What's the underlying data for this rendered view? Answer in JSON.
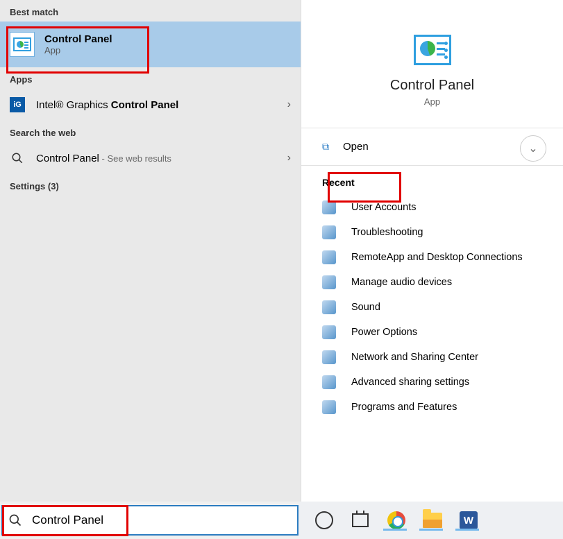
{
  "left": {
    "best_match_header": "Best match",
    "best_match": {
      "title": "Control Panel",
      "subtitle": "App"
    },
    "apps_header": "Apps",
    "intel_prefix": "Intel® Graphics ",
    "intel_bold": "Control Panel",
    "web_header": "Search the web",
    "web_title": "Control Panel",
    "web_sub": " - See web results",
    "settings_header": "Settings (3)"
  },
  "right": {
    "title": "Control Panel",
    "subtitle": "App",
    "open": "Open",
    "recent_header": "Recent",
    "recent": [
      "User Accounts",
      "Troubleshooting",
      "RemoteApp and Desktop Connections",
      "Manage audio devices",
      "Sound",
      "Power Options",
      "Network and Sharing Center",
      "Advanced sharing settings",
      "Programs and Features"
    ]
  },
  "taskbar": {
    "search_value": "Control Panel",
    "word_glyph": "W"
  }
}
